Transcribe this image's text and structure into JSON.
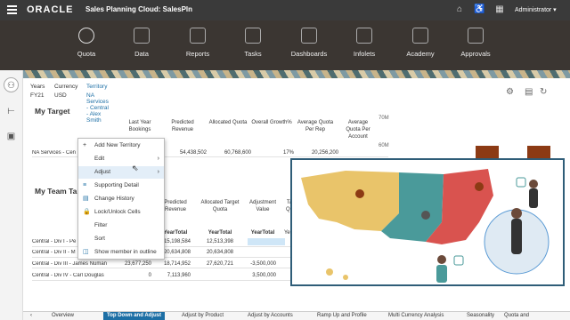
{
  "header": {
    "logo": "ORACLE",
    "app_title": "Sales Planning Cloud: SalesPln",
    "user": "Administrator ▾"
  },
  "nav": {
    "items": [
      {
        "label": "Quota"
      },
      {
        "label": "Data"
      },
      {
        "label": "Reports"
      },
      {
        "label": "Tasks"
      },
      {
        "label": "Dashboards"
      },
      {
        "label": "Infolets"
      },
      {
        "label": "Academy"
      },
      {
        "label": "Approvals"
      }
    ]
  },
  "pov": {
    "years_label": "Years",
    "years_value": "FY21",
    "currency_label": "Currency",
    "currency_value": "USD",
    "territory_label": "Territory",
    "territory_value": "NA Services - Central - Alex Smith"
  },
  "my_target": {
    "title": "My Target",
    "headers": [
      "Last Year Bookings",
      "Predicted Revenue",
      "Allocated Quota",
      "Overall Growth%",
      "Average Quota Per Rep",
      "Average Quota Per Account"
    ],
    "row_label": "NA Services - Cen",
    "values": [
      "",
      "54,438,502",
      "60,768,600",
      "17%",
      "20,256,200",
      ""
    ]
  },
  "team": {
    "title": "My Team Targ",
    "headers": [
      "Predicted Revenue",
      "Allocated Target Quota",
      "Adjustment Value",
      "Ta Qu"
    ],
    "subheaders": [
      "YearTotal",
      "YearTotal",
      "YearTotal",
      "Year"
    ],
    "rows": [
      {
        "label": "Central - Div I - Pe",
        "c1": "",
        "c2": "15,198,584",
        "c3": "12,513,398",
        "c4": ""
      },
      {
        "label": "Central - Div II - M",
        "c1": "",
        "c2": "20,634,808",
        "c3": "20,634,808",
        "c4": ""
      },
      {
        "label": "Central - Div III - James Numan",
        "c1": "23,677,250",
        "c2": "18,714,952",
        "c3": "27,620,721",
        "c4": "-3,500,000"
      },
      {
        "label": "Central - Div IV - Carl Douglas",
        "c1": "0",
        "c2": "7,113,960",
        "c3": "",
        "c4": "3,500,000"
      }
    ]
  },
  "chart_axis": {
    "top": "70M",
    "mid": "60M"
  },
  "context_menu": {
    "items": [
      {
        "label": "Add New Territory",
        "icon": "plus-icon"
      },
      {
        "label": "Edit",
        "icon": "",
        "has_submenu": true
      },
      {
        "label": "Adjust",
        "icon": "",
        "has_submenu": true
      },
      {
        "label": "Supporting Detail",
        "icon": "list-icon"
      },
      {
        "label": "Change History",
        "icon": "history-icon"
      },
      {
        "label": "Lock/Unlock Cells",
        "icon": "lock-icon"
      },
      {
        "label": "Filter",
        "icon": ""
      },
      {
        "label": "Sort",
        "icon": ""
      },
      {
        "label": "Show member in outline",
        "icon": "outline-icon"
      }
    ]
  },
  "bottom_tabs": [
    {
      "label": "Overview"
    },
    {
      "label": "Top Down and Adjust"
    },
    {
      "label": "Adjust by Product"
    },
    {
      "label": "Adjust by Accounts"
    },
    {
      "label": "Ramp Up and Profile"
    },
    {
      "label": "Multi Currency Analysis"
    },
    {
      "label": "Seasonality"
    },
    {
      "label": "Quota and"
    }
  ],
  "colors": {
    "accent": "#1d6fa5",
    "nav_bg": "#3b3632",
    "bar": "#8c3a14",
    "map_yellow": "#e9c46a",
    "map_teal": "#4a9a9a",
    "map_red": "#d9534f",
    "map_blue": "#5b9bd5"
  }
}
